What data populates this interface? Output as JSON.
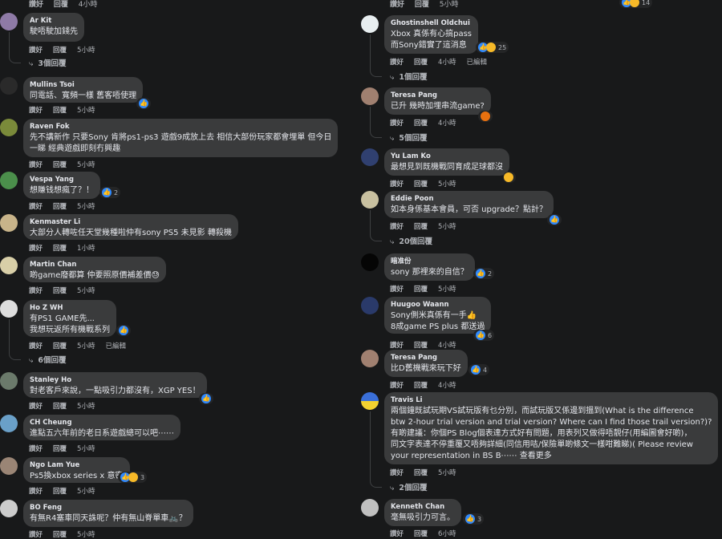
{
  "labels": {
    "like": "讚好",
    "reply": "回覆",
    "edited": "已編輯",
    "see_more": "查看更多"
  },
  "left": [
    {
      "author": "Ar Kit",
      "lines": [
        "駛唔駛加錢先"
      ],
      "time": "5小時",
      "replies": "3個回覆"
    },
    {
      "author": "Mullins Tsoi",
      "lines": [
        "同電話、寬頻一樣 舊客唔使理"
      ],
      "time": "5小時"
    },
    {
      "author": "Raven Fok",
      "lines": [
        "先不講新作 只要Sony 肯將ps1-ps3 遊戲9成放上去 相信大部份玩家都會埋單 但今日",
        "一睇 經典遊戲即刻冇興趣"
      ],
      "time": "5小時"
    },
    {
      "author": "Vespa Yang",
      "lines": [
        "想賺钱想瘋了？！"
      ],
      "time": "5小時",
      "reactions": "2"
    },
    {
      "author": "Kenmaster Li",
      "lines": [
        "大部分人轉咗任天堂幾種啦仲有sony PS5 未見影 轉殺機"
      ],
      "time": "1小時"
    },
    {
      "author": "Martin Chan",
      "lines": [
        "啲game廢都算 仲要照原價補差價😓"
      ],
      "time": "5小時"
    },
    {
      "author": "Ho Z WH",
      "lines": [
        "有PS1 GAME先...",
        "我想玩返所有機戰系列"
      ],
      "time": "5小時",
      "edited": true,
      "replies": "6個回覆"
    },
    {
      "author": "Stanley Ho",
      "lines": [
        "對老客戶來說，一點吸引力都沒有，XGP YES！"
      ],
      "time": "5小時"
    },
    {
      "author": "CH Cheung",
      "lines": [
        "進點五六年前的老日系遊戲總可以吧⋯⋯"
      ],
      "time": "5小時"
    },
    {
      "author": "Ngo Lam Yue",
      "lines": [
        "Ps5換xbox series x 意密"
      ],
      "time": "5小時",
      "reactions": "3"
    },
    {
      "author": "BO Feng",
      "lines": [
        "有無R4塞車同天誅呢？仲有無山脊單車🚲？"
      ],
      "time": "5小時"
    }
  ],
  "right": [
    {
      "author": "Ghostinshell Oldchui",
      "lines": [
        "Xbox 真係有心搞pass",
        "而Sony錯實了這消息"
      ],
      "time": "4小時",
      "edited": true,
      "reactions": "25",
      "replies": "1個回覆"
    },
    {
      "author": "Teresa Pang",
      "lines": [
        "已升 幾時加埋串流game?"
      ],
      "time": "4小時",
      "replies": "5個回覆"
    },
    {
      "author": "Yu Lam Ko",
      "lines": [
        "最想見到既機戰同育成足球都沒"
      ],
      "time": "5小時"
    },
    {
      "author": "Eddie Poon",
      "lines": [
        "如本身係基本會員，可否 upgrade？點計？"
      ],
      "time": "5小時",
      "replies": "20個回覆"
    },
    {
      "author": "暗准份",
      "lines": [
        "sony 那裡來的自信？"
      ],
      "time": "5小時",
      "reactions": "2"
    },
    {
      "author": "Huugoo Waann",
      "lines": [
        "Sony側米真係有一手👍",
        "8成game PS plus 都送過"
      ],
      "time": "4小時",
      "reactions": "6"
    },
    {
      "author": "Teresa Pang",
      "lines": [
        "比D舊機戰來玩下好"
      ],
      "time": "4小時",
      "reactions": "4"
    },
    {
      "author": "Travis Li",
      "lines": [
        "兩個鐘既試玩期VS試玩版有乜分別，而試玩版又係邊到搵到(What is the difference",
        "btw 2-hour trial version and trial version? Where can I find those trail version?)?",
        "有啲建議：你個PS Blog個表達方式好有問題，用表列又做得唔靚仔(用編圖會好啲)，",
        "同文字表達不停重覆又唔夠詳細(同信用咭/保險單啲條文一樣咁難睇)( Please review",
        "your representation in BS B⋯⋯ 查看更多"
      ],
      "time": "5小時",
      "replies": "2個回覆"
    },
    {
      "author": "Kenneth Chan",
      "lines": [
        "毫無吸引力可言。"
      ],
      "time": "6小時",
      "reactions": "3"
    }
  ],
  "top": {
    "left_time": "4小時",
    "right_time": "5小時",
    "right_react_count": "14"
  },
  "colors": {
    "background": "#18191a",
    "bubble": "#3a3b3c",
    "like_blue": "#2e89ff",
    "muted": "#b0b3b8"
  }
}
